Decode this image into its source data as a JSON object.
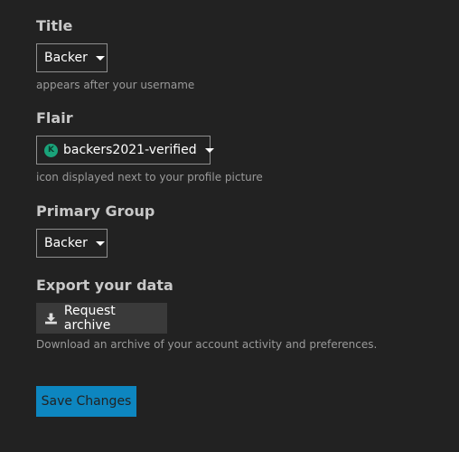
{
  "colors": {
    "background": "#222222",
    "primary_button": "#0d86c0",
    "flair_icon": "#1aa37a"
  },
  "title_section": {
    "heading": "Title",
    "selected": "Backer",
    "help": "appears after your username"
  },
  "flair_section": {
    "heading": "Flair",
    "selected": "backers2021-verified",
    "icon_letter": "K",
    "help": "icon displayed next to your profile picture"
  },
  "primary_group_section": {
    "heading": "Primary Group",
    "selected": "Backer"
  },
  "export_section": {
    "heading": "Export your data",
    "button_label": "Request archive",
    "help": "Download an archive of your account activity and preferences."
  },
  "actions": {
    "save_label": "Save Changes"
  }
}
